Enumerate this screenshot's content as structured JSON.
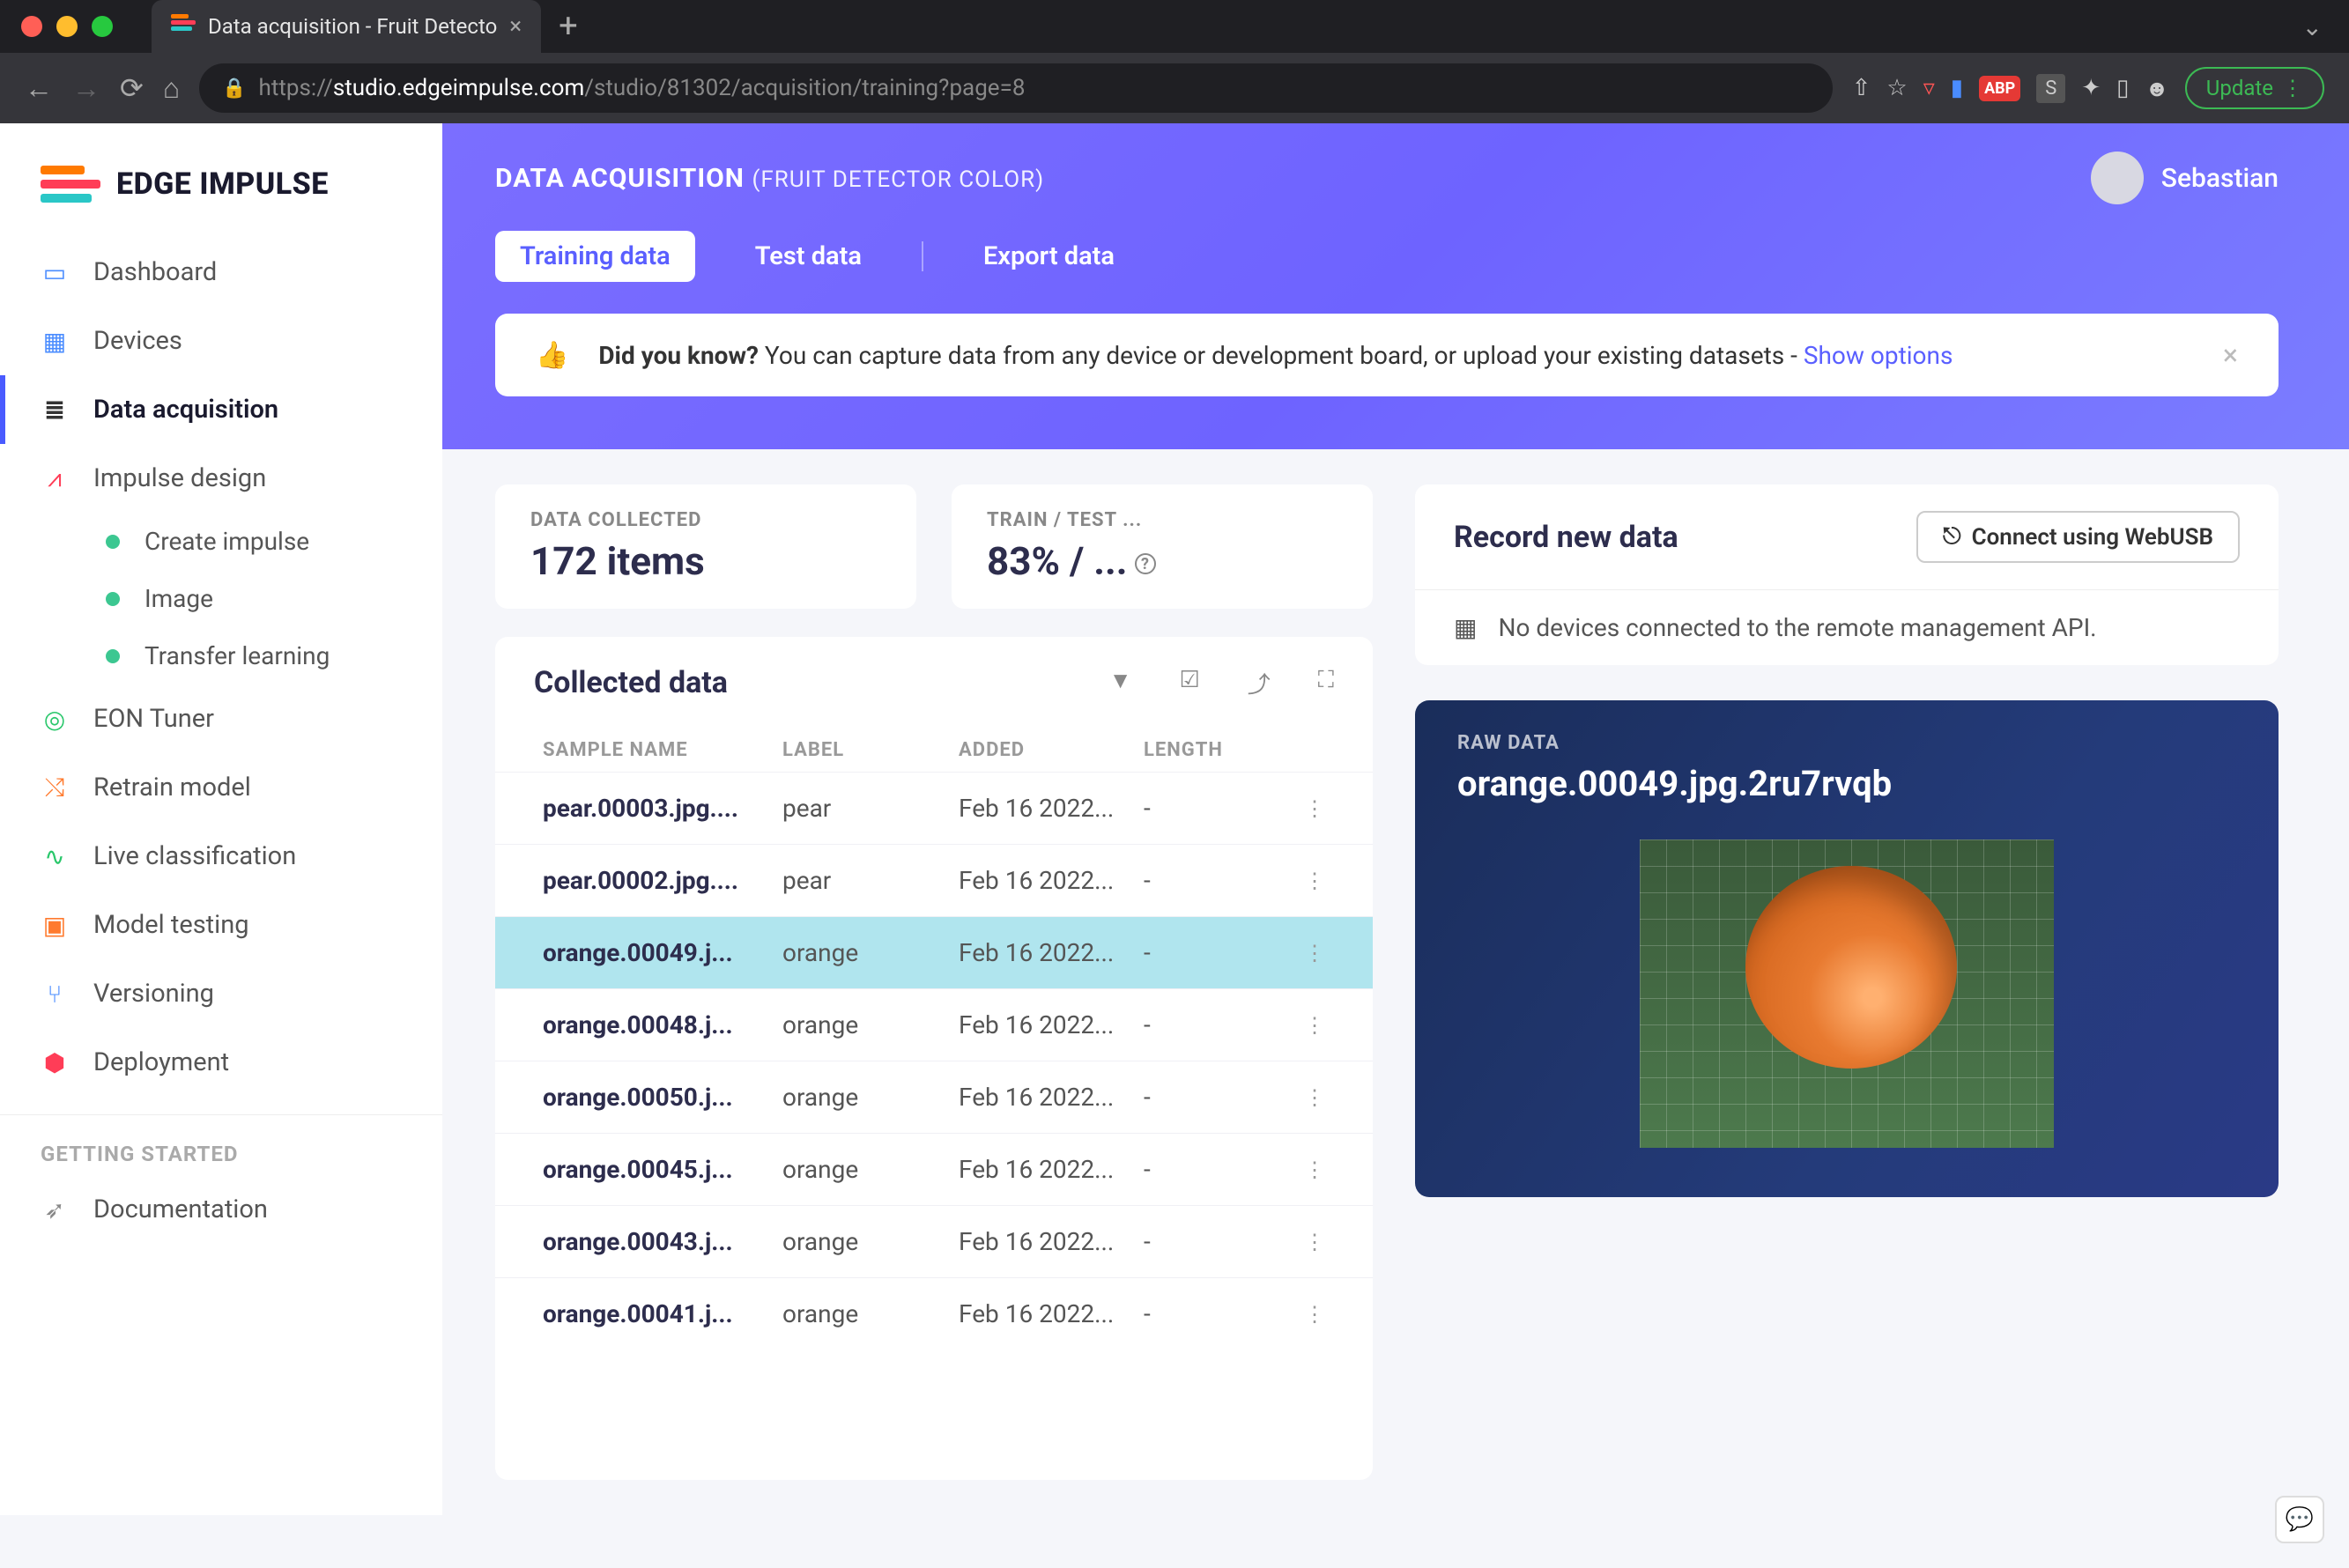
{
  "browser": {
    "tab_title": "Data acquisition - Fruit Detecto",
    "url_scheme": "https://",
    "url_host": "studio.edgeimpulse.com",
    "url_path": "/studio/81302/acquisition/training?page=8",
    "update_label": "Update"
  },
  "logo_text": "EDGE IMPULSE",
  "sidebar": {
    "items": [
      {
        "label": "Dashboard"
      },
      {
        "label": "Devices"
      },
      {
        "label": "Data acquisition"
      },
      {
        "label": "Impulse design"
      },
      {
        "label": "EON Tuner"
      },
      {
        "label": "Retrain model"
      },
      {
        "label": "Live classification"
      },
      {
        "label": "Model testing"
      },
      {
        "label": "Versioning"
      },
      {
        "label": "Deployment"
      }
    ],
    "sub_items": [
      {
        "label": "Create impulse"
      },
      {
        "label": "Image"
      },
      {
        "label": "Transfer learning"
      }
    ],
    "section_label": "GETTING STARTED",
    "doc_label": "Documentation"
  },
  "header": {
    "title": "DATA ACQUISITION",
    "subtitle": "(FRUIT DETECTOR COLOR)",
    "username": "Sebastian",
    "tabs": [
      {
        "label": "Training data"
      },
      {
        "label": "Test data"
      },
      {
        "label": "Export data"
      }
    ],
    "banner_strong": "Did you know?",
    "banner_text": " You can capture data from any device or development board, or upload your existing datasets - ",
    "banner_link": "Show options"
  },
  "stats": {
    "collected_label": "DATA COLLECTED",
    "collected_value": "172 items",
    "split_label": "TRAIN / TEST ...",
    "split_value": "83% / ..."
  },
  "table": {
    "title": "Collected data",
    "cols": {
      "name": "SAMPLE NAME",
      "label": "LABEL",
      "added": "ADDED",
      "length": "LENGTH"
    },
    "rows": [
      {
        "name": "pear.00003.jpg....",
        "label": "pear",
        "added": "Feb 16 2022...",
        "length": "-",
        "selected": false
      },
      {
        "name": "pear.00002.jpg....",
        "label": "pear",
        "added": "Feb 16 2022...",
        "length": "-",
        "selected": false
      },
      {
        "name": "orange.00049.j...",
        "label": "orange",
        "added": "Feb 16 2022...",
        "length": "-",
        "selected": true
      },
      {
        "name": "orange.00048.j...",
        "label": "orange",
        "added": "Feb 16 2022...",
        "length": "-",
        "selected": false
      },
      {
        "name": "orange.00050.j...",
        "label": "orange",
        "added": "Feb 16 2022...",
        "length": "-",
        "selected": false
      },
      {
        "name": "orange.00045.j...",
        "label": "orange",
        "added": "Feb 16 2022...",
        "length": "-",
        "selected": false
      },
      {
        "name": "orange.00043.j...",
        "label": "orange",
        "added": "Feb 16 2022...",
        "length": "-",
        "selected": false
      },
      {
        "name": "orange.00041.j...",
        "label": "orange",
        "added": "Feb 16 2022...",
        "length": "-",
        "selected": false
      }
    ]
  },
  "record": {
    "title": "Record new data",
    "connect_label": "Connect using WebUSB",
    "no_devices": "No devices connected to the remote management API."
  },
  "raw": {
    "label": "RAW DATA",
    "filename": "orange.00049.jpg.2ru7rvqb"
  }
}
